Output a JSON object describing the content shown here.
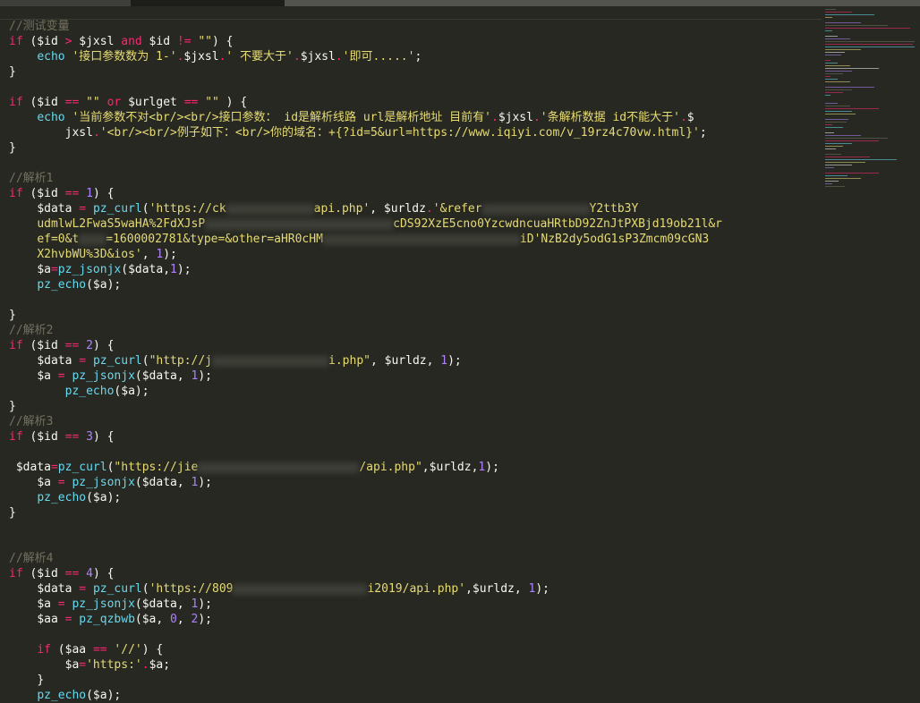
{
  "code": {
    "l1": "//测试变量",
    "l2_if": "if",
    "l2_a": " ($id ",
    "l2_gt": ">",
    "l2_b": " $jxsl ",
    "l2_and": "and",
    "l2_c": " $id ",
    "l2_ne": "!=",
    "l2_d": " ",
    "l2_str": "\"\"",
    "l2_e": ") {",
    "l3_echo": "echo",
    "l3_s1": "'接口参数数为 1-'",
    "l3_dot1": ".",
    "l3_v1": "$jxsl",
    "l3_dot2": ".",
    "l3_s2": "' 不要大于'",
    "l3_dot3": ".",
    "l3_v2": "$jxsl",
    "l3_dot4": ".",
    "l3_s3": "'即可.....'",
    "l3_end": ";",
    "l4": "}",
    "l6_if": "if",
    "l6_a": " ($id ",
    "l6_eq": "==",
    "l6_b": " ",
    "l6_str1": "\"\"",
    "l6_or": "or",
    "l6_c": " $urlget ",
    "l6_eq2": "==",
    "l6_str2": "\"\"",
    "l6_d": " ) {",
    "l7_echo": "echo",
    "l7_s1": "'当前参数不对<br/><br/>接口参数： id是解析线路 url是解析地址 目前有'",
    "l7_dot1": ".",
    "l7_v1": "$jxsl",
    "l7_dot2": ".",
    "l7_s2": "'条解析数据 id不能大于'",
    "l7_dot3": ".",
    "l7_v2": "$",
    "l8_v": "jxsl",
    "l8_dot": ".",
    "l8_s": "'<br/><br/>例子如下：<br/>你的域名：+{?id=5&url=https://www.iqiyi.com/v_19rz4c70vw.html}'",
    "l8_end": ";",
    "l9": "}",
    "l11": "//解析1",
    "l12_if": "if",
    "l12_a": " ($id ",
    "l12_eq": "==",
    "l12_b": " ",
    "l12_n": "1",
    "l12_c": ") {",
    "l13_a": "$data ",
    "l13_eq": "=",
    "l13_fn": "pz_curl",
    "l13_s1": "'https://ck",
    "l13_s2": "api.php'",
    "l13_b": ", $urldz",
    "l13_dot": ".",
    "l13_s3": "'&refer",
    "l13_s4": "Y2ttb3Y",
    "l14_s1": "udmlwL2FwaS5waHA%2FdXJsP",
    "l14_s2": "cDS92XzE5cno0YzcwdncuaHRtbD92ZnJtPXBjd19ob21l&r",
    "l15_s1": "ef=0&t",
    "l15_s2": "=1600002781&type=&other=aHR0cHM",
    "l15_s3": "iD'NzB2dy5odG1sP3Zmcm09cGN3",
    "l16_s": "X2hvbWU%3D&ios'",
    "l16_b": ", ",
    "l16_n": "1",
    "l16_c": ");",
    "l17_a": "$a",
    "l17_eq": "=",
    "l17_fn": "pz_jsonjx",
    "l17_b": "($data,",
    "l17_n": "1",
    "l17_c": ");",
    "l18_fn": "pz_echo",
    "l18_b": "($a);",
    "l20": "}",
    "l21": "//解析2",
    "l22_if": "if",
    "l22_a": " ($id ",
    "l22_eq": "==",
    "l22_b": " ",
    "l22_n": "2",
    "l22_c": ") {",
    "l23_a": "$data ",
    "l23_eq": "=",
    "l23_fn": "pz_curl",
    "l23_s1": "\"http://j",
    "l23_s2": "i.php\"",
    "l23_b": ", $urldz, ",
    "l23_n": "1",
    "l23_c": ");",
    "l24_a": "$a ",
    "l24_eq": "=",
    "l24_fn": "pz_jsonjx",
    "l24_b": "($data, ",
    "l24_n": "1",
    "l24_c": ");",
    "l25_fn": "pz_echo",
    "l25_b": "($a);",
    "l26": "}",
    "l27": "//解析3",
    "l28_if": "if",
    "l28_a": " ($id ",
    "l28_eq": "==",
    "l28_b": " ",
    "l28_n": "3",
    "l28_c": ") {",
    "l30_a": "$data",
    "l30_eq": "=",
    "l30_fn": "pz_curl",
    "l30_s1": "\"https://jie",
    "l30_s2": "/api.php\"",
    "l30_b": ",$urldz,",
    "l30_n": "1",
    "l30_c": ");",
    "l31_a": "$a ",
    "l31_eq": "=",
    "l31_fn": "pz_jsonjx",
    "l31_b": "($data, ",
    "l31_n": "1",
    "l31_c": ");",
    "l32_fn": "pz_echo",
    "l32_b": "($a);",
    "l33": "}",
    "l36": "//解析4",
    "l37_if": "if",
    "l37_a": " ($id ",
    "l37_eq": "==",
    "l37_b": " ",
    "l37_n": "4",
    "l37_c": ") {",
    "l38_a": "$data ",
    "l38_eq": "=",
    "l38_fn": "pz_curl",
    "l38_s1": "'https://809",
    "l38_s2": "i2019/api.php'",
    "l38_b": ",$urldz, ",
    "l38_n": "1",
    "l38_c": ");",
    "l39_a": "$a ",
    "l39_eq": "=",
    "l39_fn": "pz_jsonjx",
    "l39_b": "($data, ",
    "l39_n": "1",
    "l39_c": ");",
    "l40_a": "$aa ",
    "l40_eq": "=",
    "l40_fn": "pz_qzbwb",
    "l40_b": "($a, ",
    "l40_n1": "0",
    "l40_c": ", ",
    "l40_n2": "2",
    "l40_d": ");",
    "l42_if": "if",
    "l42_a": " ($aa ",
    "l42_eq": "==",
    "l42_b": " ",
    "l42_s": "'//'",
    "l42_c": ") {",
    "l43_a": "$a",
    "l43_eq": "=",
    "l43_s": "'https:'",
    "l43_dot": ".",
    "l43_b": "$a;",
    "l44": "}",
    "l45_fn": "pz_echo",
    "l45_b": "($a);"
  },
  "colors": {
    "background": "#272822",
    "comment": "#75715e",
    "keyword": "#f92672",
    "function": "#66d9ef",
    "string": "#e6db74",
    "number": "#ae81ff",
    "default": "#f8f8f2"
  }
}
